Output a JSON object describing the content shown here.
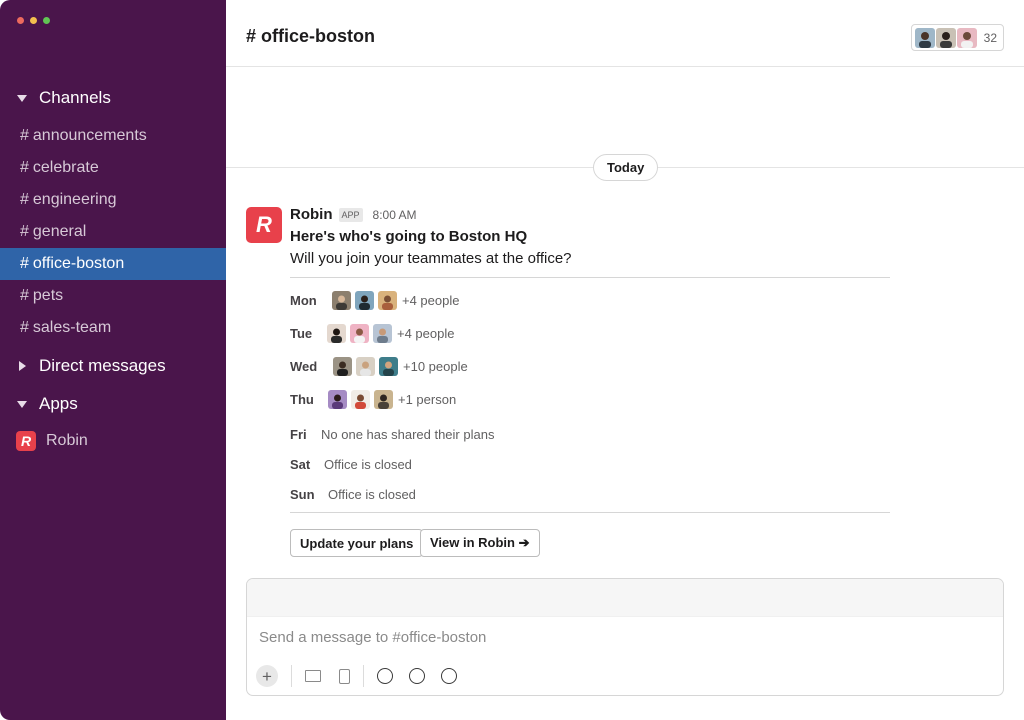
{
  "sidebar": {
    "sections": {
      "channels": "Channels",
      "direct_messages": "Direct messages",
      "apps": "Apps"
    },
    "channels": [
      {
        "hash": "#",
        "name": "announcements"
      },
      {
        "hash": "#",
        "name": "celebrate"
      },
      {
        "hash": "#",
        "name": "engineering"
      },
      {
        "hash": "#",
        "name": "general"
      },
      {
        "hash": "#",
        "name": "office-boston",
        "active": true
      },
      {
        "hash": "#",
        "name": "pets"
      },
      {
        "hash": "#",
        "name": "sales-team"
      }
    ],
    "apps": [
      {
        "name": "Robin",
        "logo_letter": "R"
      }
    ]
  },
  "header": {
    "channel_title": "# office-boston",
    "member_count": "32"
  },
  "divider": {
    "label": "Today"
  },
  "message": {
    "avatar_letter": "R",
    "sender": "Robin",
    "badge": "APP",
    "time": "8:00 AM",
    "title": "Here's who's going to Boston HQ",
    "subtitle": "Will you join your teammates at the office?",
    "days": [
      {
        "day": "Mon",
        "text": "+4 people"
      },
      {
        "day": "Tue",
        "text": "+4 people"
      },
      {
        "day": "Wed",
        "text": "+10 people"
      },
      {
        "day": "Thu",
        "text": "+1 person"
      },
      {
        "day": "Fri",
        "text": "No one has shared their plans"
      },
      {
        "day": "Sat",
        "text": "Office is closed"
      },
      {
        "day": "Sun",
        "text": "Office is closed"
      }
    ],
    "buttons": {
      "update": "Update your plans",
      "view": "View in Robin ➔"
    }
  },
  "composer": {
    "placeholder": "Send a message to #office-boston",
    "plus": "+"
  },
  "colors": {
    "sidebar_bg": "#4a154b",
    "active_channel": "#2f64a8",
    "robin_red": "#e8414b"
  }
}
